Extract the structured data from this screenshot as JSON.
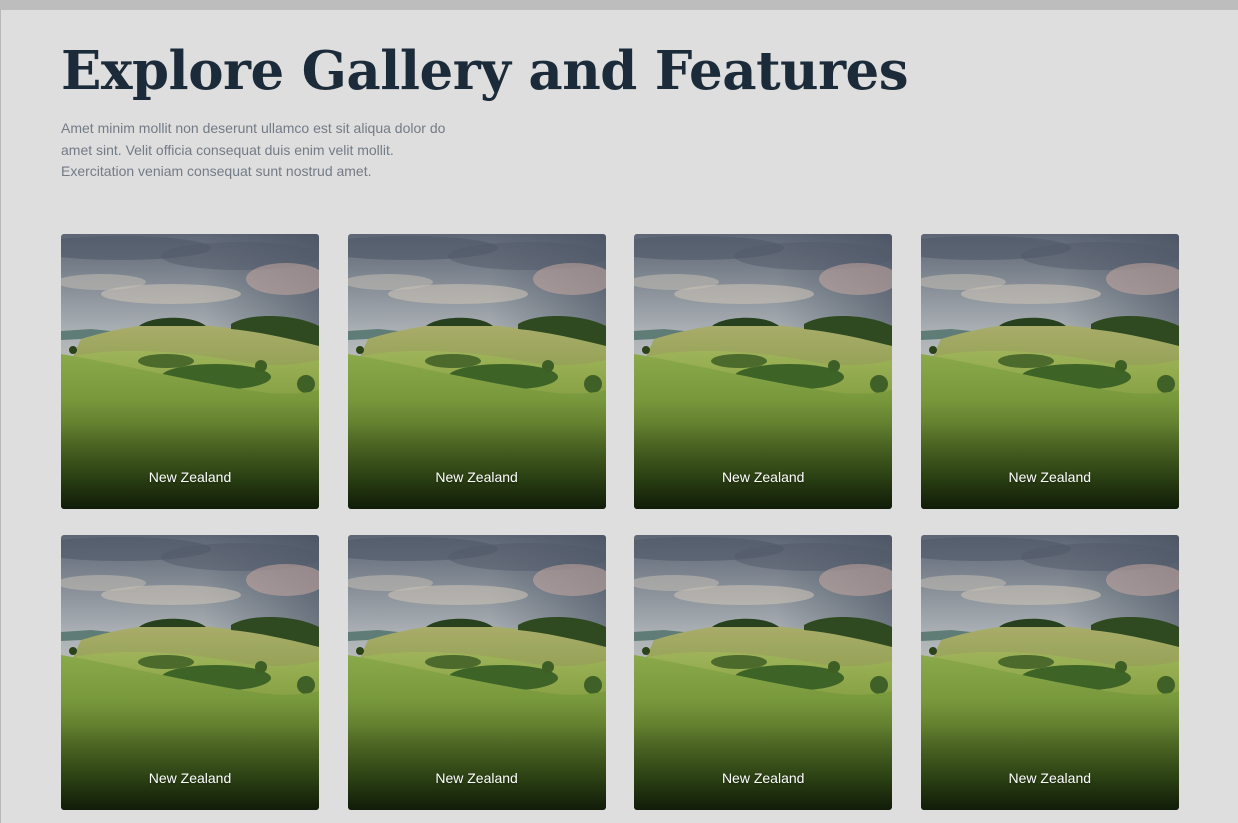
{
  "header": {
    "title": "Explore Gallery and Features",
    "description": "Amet minim mollit non deserunt ullamco est sit aliqua dolor do amet sint. Velit officia consequat duis enim velit mollit. Exercitation veniam consequat sunt nostrud amet."
  },
  "gallery": {
    "cards": [
      {
        "caption": "New Zealand"
      },
      {
        "caption": "New Zealand"
      },
      {
        "caption": "New Zealand"
      },
      {
        "caption": "New Zealand"
      },
      {
        "caption": "New Zealand"
      },
      {
        "caption": "New Zealand"
      },
      {
        "caption": "New Zealand"
      },
      {
        "caption": "New Zealand"
      }
    ]
  },
  "colors": {
    "background": "#dedede",
    "title": "#1c2b3a",
    "body_text": "#737b86",
    "caption": "#ffffff"
  },
  "icons": {
    "card_image": "landscape-photo"
  }
}
